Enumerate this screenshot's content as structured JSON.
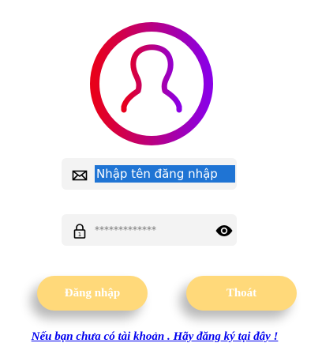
{
  "avatar": {
    "icon": "user-icon",
    "ring_colors": [
      "#e8001a",
      "#8a00e6"
    ]
  },
  "username": {
    "icon": "envelope-icon",
    "value": "Nhập tên đăng nhập",
    "selected": true
  },
  "password": {
    "icon": "lock-icon",
    "value": "*************",
    "toggle_icon": "eye-icon"
  },
  "buttons": {
    "login_label": "Đăng nhập",
    "exit_label": "Thoát"
  },
  "register": {
    "text": "Nếu bạn chưa có tài khoản . Hãy đăng ký tại đây !"
  },
  "colors": {
    "button_bg": "#ffd97a",
    "field_bg": "#f3f3f3",
    "selection_bg": "#1f74d4",
    "link": "#0000ee"
  }
}
